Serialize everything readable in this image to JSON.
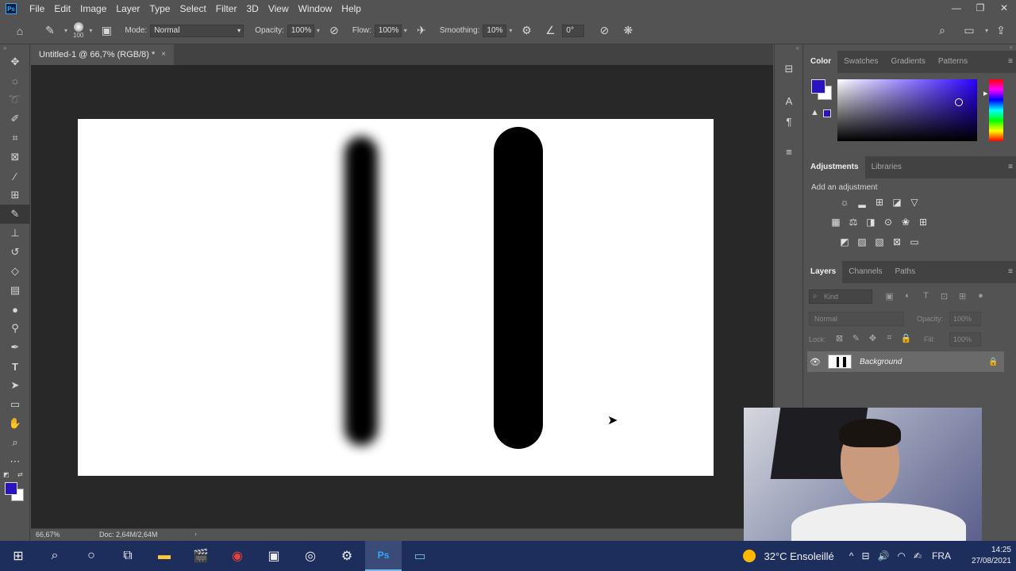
{
  "menubar": {
    "logo": "Ps",
    "items": [
      "File",
      "Edit",
      "Image",
      "Layer",
      "Type",
      "Select",
      "Filter",
      "3D",
      "View",
      "Window",
      "Help"
    ],
    "win_controls": [
      "—",
      "❐",
      "✕"
    ]
  },
  "options": {
    "brush_size": "100",
    "mode_label": "Mode:",
    "mode_value": "Normal",
    "opacity_label": "Opacity:",
    "opacity_value": "100%",
    "flow_label": "Flow:",
    "flow_value": "100%",
    "smoothing_label": "Smoothing:",
    "smoothing_value": "10%",
    "angle_value": "0°"
  },
  "document": {
    "tab_title": "Untitled-1 @ 66,7% (RGB/8) *",
    "close": "×"
  },
  "colors": {
    "foreground": "#2a12c0",
    "background": "#ffffff",
    "canvas": "#ffffff",
    "stroke": "#000000"
  },
  "color_panel": {
    "tabs": [
      "Color",
      "Swatches",
      "Gradients",
      "Patterns"
    ]
  },
  "adjustments_panel": {
    "tabs": [
      "Adjustments",
      "Libraries"
    ],
    "add_label": "Add an adjustment"
  },
  "layers_panel": {
    "tabs": [
      "Layers",
      "Channels",
      "Paths"
    ],
    "kind_placeholder": "Kind",
    "blend_mode": "Normal",
    "opacity_label": "Opacity:",
    "opacity_value": "100%",
    "lock_label": "Lock:",
    "fill_label": "Fill:",
    "fill_value": "100%",
    "layers": [
      {
        "name": "Background",
        "visible": true,
        "locked": true
      }
    ]
  },
  "status": {
    "zoom": "66,67%",
    "doc": "Doc: 2,64M/2,64M"
  },
  "taskbar": {
    "weather_temp": "32°C",
    "weather_text": "Ensoleillé",
    "language": "FRA",
    "time": "14:25",
    "date": "27/08/2021"
  }
}
